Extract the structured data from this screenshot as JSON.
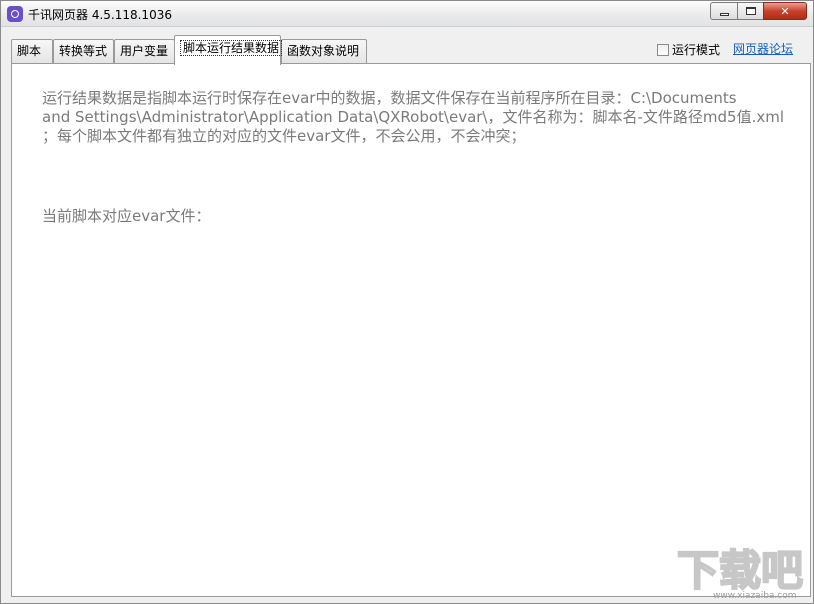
{
  "window": {
    "title": "千讯网页器 4.5.118.1036"
  },
  "tabs": [
    {
      "label": "脚本",
      "active": false
    },
    {
      "label": "转换等式",
      "active": false
    },
    {
      "label": "用户变量",
      "active": false
    },
    {
      "label": "脚本运行结果数据",
      "active": true
    },
    {
      "label": "函数对象说明",
      "active": false
    }
  ],
  "toolbar": {
    "run_mode_label": "运行模式",
    "run_mode_checked": false,
    "forum_link": "网页器论坛"
  },
  "content": {
    "description_lines": [
      "运行结果数据是指脚本运行时保存在evar中的数据，数据文件保存在当前程序所在目录：C:\\Documents",
      "and Settings\\Administrator\\Application Data\\QXRobot\\evar\\，文件名称为：脚本名-文件路径md5值.xml",
      "；每个脚本文件都有独立的对应的文件evar文件，不会公用，不会冲突；"
    ],
    "current_evar_label": "当前脚本对应evar文件："
  },
  "watermark": {
    "text": "下载吧",
    "sub": "www.xiazaiba.com"
  }
}
